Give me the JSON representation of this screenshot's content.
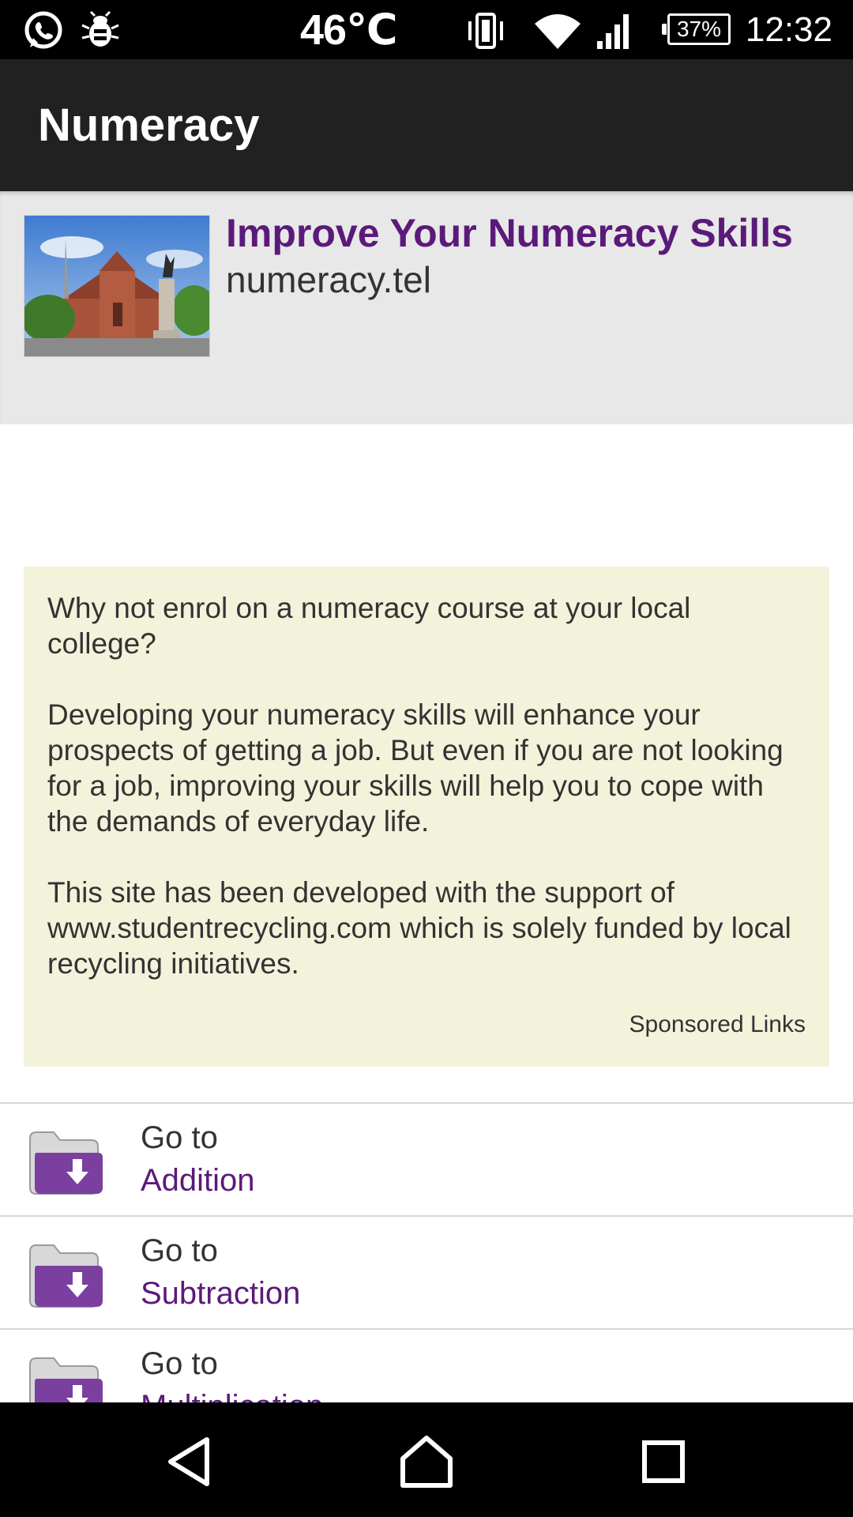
{
  "status_bar": {
    "temperature": "46℃",
    "battery": "37%",
    "time": "12:32",
    "icons": [
      "whatsapp-icon",
      "bug-icon",
      "vibrate-icon",
      "wifi-icon",
      "signal-icon",
      "battery-icon"
    ]
  },
  "app_bar": {
    "title": "Numeracy"
  },
  "ad": {
    "title": "Improve Your Numeracy Skills",
    "url": "numeracy.tel"
  },
  "info": {
    "paragraphs": [
      "Why not enrol on a numeracy course at your local college?",
      "Developing your numeracy skills will enhance your prospects of getting a job. But even if you are not looking for a job, improving your skills will help you to cope with the demands of everyday life.",
      "This site has been developed with the support of www.studentrecycling.com which is solely funded by local recycling initiatives."
    ],
    "sponsored": "Sponsored Links"
  },
  "list": {
    "items": [
      {
        "prefix": "Go to",
        "label": "Addition"
      },
      {
        "prefix": "Go to",
        "label": "Subtraction"
      },
      {
        "prefix": "Go to",
        "label": "Multiplication"
      }
    ]
  },
  "colors": {
    "accent": "#5b1a7a",
    "appbar": "#212121",
    "info_bg": "#f3f3dc",
    "folder": "#7b3fa0"
  },
  "nav_bar": {
    "icons": [
      "back-icon",
      "home-icon",
      "recents-icon"
    ]
  }
}
